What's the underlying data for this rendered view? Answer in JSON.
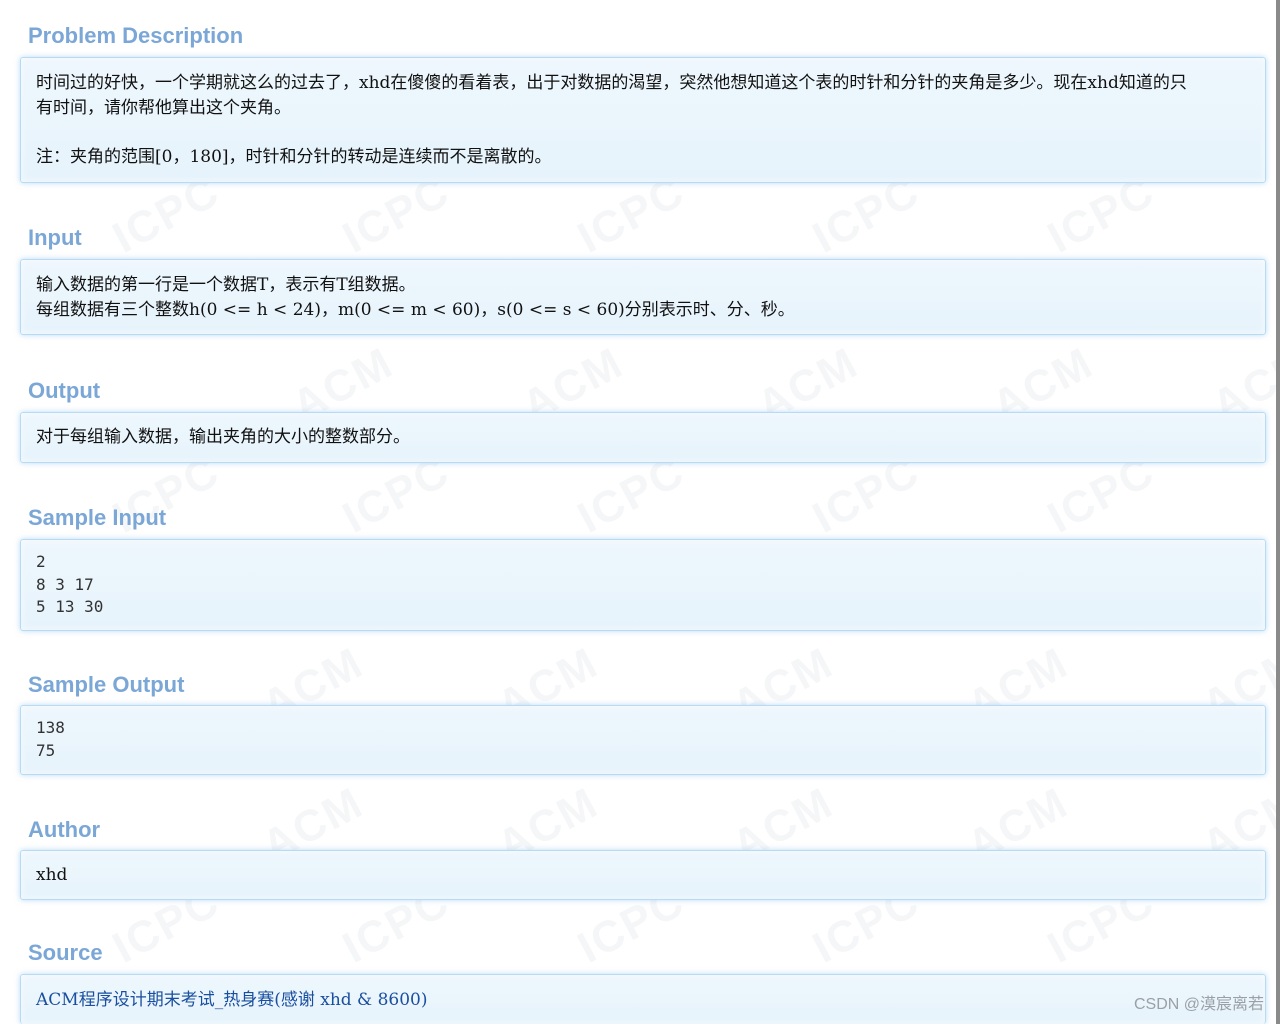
{
  "sections": {
    "problem_description": {
      "title": "Problem Description",
      "line1": "时间过的好快，一个学期就这么的过去了，xhd在傻傻的看着表，出于对数据的渴望，突然他想知道这个表的时针和分针的夹角是多少。现在xhd知道的只",
      "line2": "有时间，请你帮他算出这个夹角。",
      "note": "注：夹角的范围[0，180]，时针和分针的转动是连续而不是离散的。"
    },
    "input": {
      "title": "Input",
      "line1": "输入数据的第一行是一个数据T，表示有T组数据。",
      "line2": "每组数据有三个整数h(0 <= h < 24)，m(0 <= m < 60)，s(0 <= s < 60)分别表示时、分、秒。"
    },
    "output": {
      "title": "Output",
      "line1": "对于每组输入数据，输出夹角的大小的整数部分。"
    },
    "sample_input": {
      "title": "Sample Input",
      "lines": [
        "2",
        "8 3 17",
        "5 13 30"
      ]
    },
    "sample_output": {
      "title": "Sample Output",
      "lines": [
        "138",
        "75"
      ]
    },
    "author": {
      "title": "Author",
      "value": "xhd"
    },
    "source": {
      "title": "Source",
      "link_text": "ACM程序设计期末考试_热身赛(感谢 xhd & 8600)"
    }
  },
  "footer": {
    "csdn_watermark": "CSDN @漠宸离若"
  },
  "colors": {
    "section_title": "#7ba7d7",
    "panel_border": "#b8dbf3",
    "panel_background": "#eef7fd",
    "link": "#1a4fa0"
  }
}
